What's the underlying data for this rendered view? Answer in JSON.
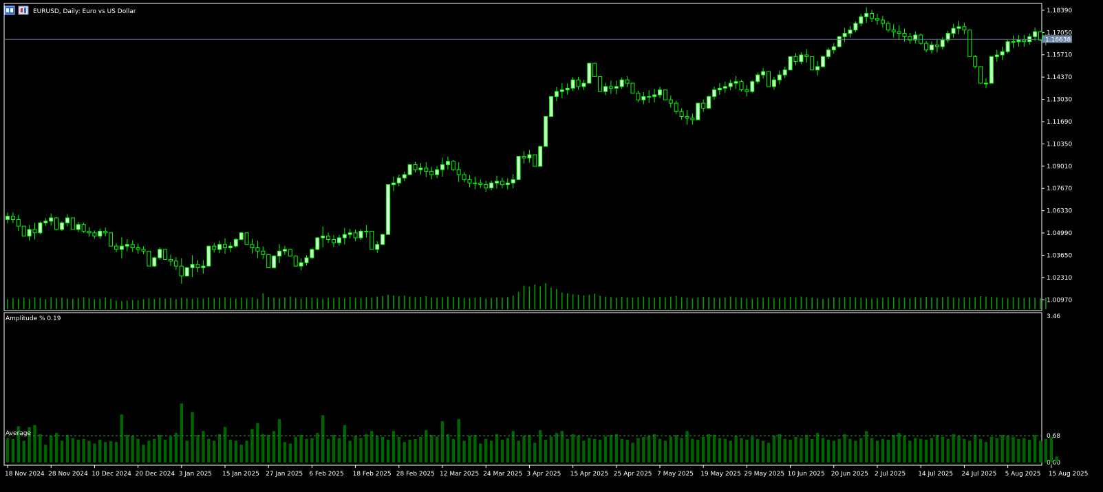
{
  "window": {
    "title": "EURUSD, Daily: Euro vs US Dollar"
  },
  "colors": {
    "background": "#000000",
    "frame": "#ffffff",
    "bull_body": "#ccffcc",
    "bear_body": "#000000",
    "candle_outline": "#00ff00",
    "volume": "#00a000",
    "amplitude_bar": "#006400",
    "current_price_line": "#5a6e8c",
    "price_tag_bg": "#6e86aa",
    "average_line": "#339933"
  },
  "icons": [
    "chart-window-icon",
    "chart-settings-icon"
  ],
  "price_panel": {
    "current_price": "1.16638",
    "y_ticks": [
      "1.18390",
      "1.17050",
      "1.15710",
      "1.14370",
      "1.13030",
      "1.11690",
      "1.10350",
      "1.09010",
      "1.07670",
      "1.06330",
      "1.04990",
      "1.03650",
      "1.02310",
      "1.00970"
    ]
  },
  "indicator_panel": {
    "title": "Amplitude % 0.19",
    "average_label": "Average",
    "y_ticks": [
      "3.46",
      "0.68",
      "0.00"
    ]
  },
  "x_axis": {
    "labels": [
      "18 Nov 2024",
      "28 Nov 2024",
      "10 Dec 2024",
      "20 Dec 2024",
      "3 Jan 2025",
      "15 Jan 2025",
      "27 Jan 2025",
      "6 Feb 2025",
      "18 Feb 2025",
      "28 Feb 2025",
      "12 Mar 2025",
      "24 Mar 2025",
      "3 Apr 2025",
      "15 Apr 2025",
      "25 Apr 2025",
      "7 May 2025",
      "19 May 2025",
      "29 May 2025",
      "10 Jun 2025",
      "20 Jun 2025",
      "2 Jul 2025",
      "14 Jul 2025",
      "24 Jul 2025",
      "5 Aug 2025",
      "15 Aug 2025"
    ]
  },
  "chart_data": [
    {
      "type": "candlestick",
      "title": "EURUSD, Daily: Euro vs US Dollar",
      "ylim": [
        1.0032,
        1.188
      ],
      "note_axis": "y in price units; x labels every 8 bars",
      "closes": [
        1.06,
        1.058,
        1.054,
        1.048,
        1.052,
        1.05,
        1.056,
        1.057,
        1.059,
        1.052,
        1.056,
        1.059,
        1.052,
        1.055,
        1.051,
        1.05,
        1.048,
        1.051,
        1.05,
        1.042,
        1.04,
        1.042,
        1.043,
        1.041,
        1.04,
        1.039,
        1.03,
        1.035,
        1.04,
        1.034,
        1.033,
        1.03,
        1.024,
        1.029,
        1.031,
        1.029,
        1.03,
        1.042,
        1.04,
        1.043,
        1.041,
        1.042,
        1.046,
        1.05,
        1.043,
        1.041,
        1.039,
        1.037,
        1.029,
        1.036,
        1.039,
        1.04,
        1.036,
        1.03,
        1.032,
        1.035,
        1.04,
        1.047,
        1.048,
        1.046,
        1.044,
        1.047,
        1.049,
        1.05,
        1.047,
        1.051,
        1.051,
        1.04,
        1.043,
        1.049,
        1.079,
        1.08,
        1.083,
        1.085,
        1.091,
        1.088,
        1.089,
        1.087,
        1.085,
        1.088,
        1.091,
        1.093,
        1.088,
        1.085,
        1.082,
        1.08,
        1.08,
        1.079,
        1.077,
        1.08,
        1.081,
        1.079,
        1.08,
        1.082,
        1.096,
        1.095,
        1.097,
        1.09,
        1.102,
        1.12,
        1.132,
        1.135,
        1.136,
        1.137,
        1.142,
        1.138,
        1.14,
        1.152,
        1.144,
        1.135,
        1.138,
        1.137,
        1.138,
        1.142,
        1.14,
        1.134,
        1.13,
        1.132,
        1.132,
        1.133,
        1.136,
        1.13,
        1.128,
        1.123,
        1.12,
        1.119,
        1.118,
        1.128,
        1.125,
        1.132,
        1.136,
        1.137,
        1.138,
        1.14,
        1.141,
        1.136,
        1.135,
        1.141,
        1.145,
        1.147,
        1.138,
        1.142,
        1.145,
        1.148,
        1.156,
        1.153,
        1.157,
        1.156,
        1.148,
        1.15,
        1.156,
        1.16,
        1.162,
        1.168,
        1.17,
        1.172,
        1.176,
        1.18,
        1.182,
        1.179,
        1.178,
        1.176,
        1.172,
        1.171,
        1.17,
        1.168,
        1.166,
        1.169,
        1.164,
        1.16,
        1.163,
        1.162,
        1.166,
        1.17,
        1.173,
        1.174,
        1.172,
        1.156,
        1.15,
        1.14,
        1.14,
        1.156,
        1.157,
        1.159,
        1.165,
        1.165,
        1.166,
        1.165,
        1.168,
        1.171,
        1.166,
        1.1664
      ],
      "volume_fraction": [
        0.35,
        0.38,
        0.37,
        0.4,
        0.36,
        0.41,
        0.39,
        0.35,
        0.42,
        0.38,
        0.4,
        0.37,
        0.36,
        0.39,
        0.41,
        0.38,
        0.35,
        0.37,
        0.4,
        0.36,
        0.3,
        0.28,
        0.3,
        0.32,
        0.31,
        0.35,
        0.38,
        0.36,
        0.4,
        0.37,
        0.39,
        0.35,
        0.4,
        0.38,
        0.36,
        0.39,
        0.37,
        0.41,
        0.38,
        0.4,
        0.42,
        0.39,
        0.37,
        0.4,
        0.38,
        0.41,
        0.36,
        0.55,
        0.42,
        0.4,
        0.38,
        0.41,
        0.44,
        0.39,
        0.37,
        0.42,
        0.4,
        0.38,
        0.36,
        0.4,
        0.39,
        0.41,
        0.38,
        0.43,
        0.4,
        0.39,
        0.42,
        0.4,
        0.44,
        0.46,
        0.5,
        0.48,
        0.45,
        0.47,
        0.44,
        0.42,
        0.43,
        0.45,
        0.41,
        0.4,
        0.42,
        0.44,
        0.43,
        0.41,
        0.39,
        0.38,
        0.4,
        0.42,
        0.37,
        0.39,
        0.41,
        0.4,
        0.42,
        0.47,
        0.6,
        0.82,
        0.78,
        0.85,
        0.8,
        0.9,
        0.75,
        0.7,
        0.58,
        0.55,
        0.52,
        0.5,
        0.48,
        0.5,
        0.54,
        0.46,
        0.44,
        0.42,
        0.4,
        0.43,
        0.41,
        0.4,
        0.42,
        0.44,
        0.41,
        0.4,
        0.43,
        0.42,
        0.44,
        0.46,
        0.42,
        0.4,
        0.38,
        0.41,
        0.43,
        0.42,
        0.4,
        0.39,
        0.41,
        0.44,
        0.42,
        0.4,
        0.38,
        0.37,
        0.41,
        0.4,
        0.42,
        0.39,
        0.38,
        0.4,
        0.43,
        0.41,
        0.44,
        0.42,
        0.4,
        0.38,
        0.36,
        0.39,
        0.41,
        0.4,
        0.42,
        0.43,
        0.41,
        0.4,
        0.38,
        0.37,
        0.39,
        0.4,
        0.42,
        0.41,
        0.39,
        0.4,
        0.38,
        0.42,
        0.4,
        0.43,
        0.41,
        0.4,
        0.42,
        0.44,
        0.4,
        0.39,
        0.41,
        0.4,
        0.42,
        0.45,
        0.44,
        0.43,
        0.41,
        0.4,
        0.38,
        0.42,
        0.4,
        0.39,
        0.41,
        0.4,
        0.38,
        0.4
      ]
    },
    {
      "type": "bar",
      "title": "Amplitude % 0.19",
      "ylabel": "",
      "ylim": [
        0.0,
        3.46
      ],
      "average": 0.68,
      "values": [
        0.62,
        0.6,
        0.92,
        0.55,
        0.9,
        0.95,
        0.72,
        0.45,
        0.68,
        0.75,
        0.55,
        0.7,
        0.62,
        0.58,
        0.6,
        0.55,
        0.48,
        0.58,
        0.52,
        0.54,
        0.52,
        1.22,
        0.7,
        0.68,
        0.6,
        0.45,
        0.55,
        0.6,
        0.7,
        0.58,
        0.66,
        0.75,
        1.5,
        0.55,
        1.28,
        0.7,
        0.8,
        0.6,
        0.55,
        0.72,
        0.9,
        0.58,
        0.55,
        0.45,
        0.55,
        0.85,
        1.0,
        0.72,
        0.7,
        0.8,
        1.1,
        0.52,
        0.48,
        0.65,
        0.7,
        0.6,
        0.62,
        0.75,
        1.2,
        0.6,
        0.7,
        0.62,
        0.95,
        0.55,
        0.68,
        0.62,
        0.72,
        0.8,
        0.68,
        0.65,
        0.58,
        0.8,
        0.65,
        0.52,
        0.58,
        0.6,
        0.65,
        0.82,
        0.7,
        0.66,
        1.05,
        0.72,
        0.6,
        1.1,
        0.55,
        0.68,
        0.7,
        0.48,
        0.6,
        0.55,
        0.72,
        0.58,
        0.62,
        0.8,
        0.55,
        0.68,
        0.7,
        0.5,
        0.82,
        0.58,
        0.66,
        0.75,
        0.8,
        0.6,
        0.72,
        0.68,
        0.55,
        0.62,
        0.6,
        0.58,
        0.66,
        0.7,
        0.72,
        0.6,
        0.58,
        0.5,
        0.62,
        0.65,
        0.68,
        0.72,
        0.6,
        0.55,
        0.66,
        0.7,
        0.62,
        0.8,
        0.6,
        0.58,
        0.65,
        0.72,
        0.7,
        0.62,
        0.6,
        0.55,
        0.68,
        0.62,
        0.58,
        0.66,
        0.6,
        0.55,
        0.5,
        0.68,
        0.72,
        0.6,
        0.58,
        0.65,
        0.62,
        0.7,
        0.6,
        0.75,
        0.62,
        0.58,
        0.55,
        0.6,
        0.72,
        0.6,
        0.55,
        0.62,
        0.8,
        0.62,
        0.55,
        0.6,
        0.58,
        0.7,
        0.75,
        0.68,
        0.55,
        0.62,
        0.6,
        0.58,
        0.62,
        0.7,
        0.65,
        0.6,
        0.72,
        0.68,
        0.6,
        0.55,
        0.7,
        0.6,
        0.52,
        0.65,
        0.62,
        0.7,
        0.68,
        0.65,
        0.6,
        0.62,
        0.58,
        0.7,
        0.55,
        0.6,
        0.65,
        0.15
      ]
    }
  ]
}
